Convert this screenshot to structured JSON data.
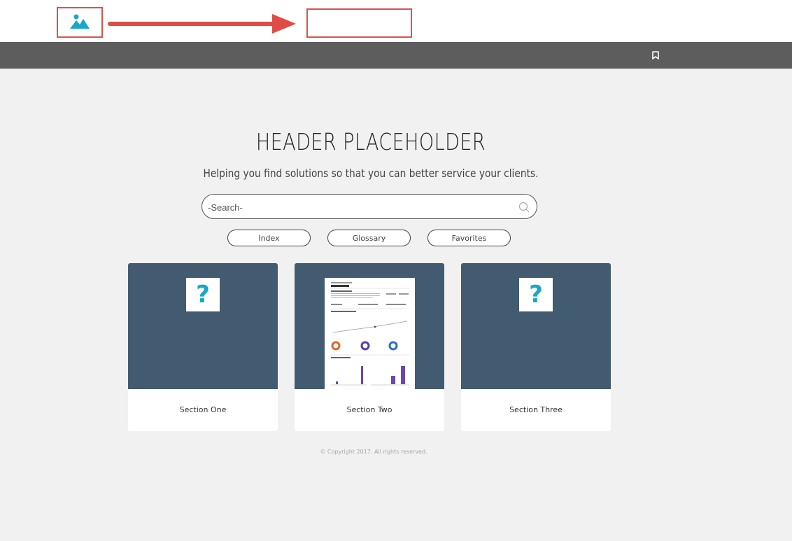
{
  "header": {
    "logo_icon": "image-placeholder-icon",
    "bookmark_icon": "bookmark-icon"
  },
  "hero": {
    "title": "HEADER PLACEHOLDER",
    "subtitle": "Helping you find solutions so that you can better service your clients."
  },
  "search": {
    "placeholder": "-Search-",
    "icon": "search-icon"
  },
  "links": [
    {
      "label": "Index"
    },
    {
      "label": "Glossary"
    },
    {
      "label": "Favorites"
    }
  ],
  "cards": [
    {
      "label": "Section One",
      "media": "question-mark-icon"
    },
    {
      "label": "Section Two",
      "media": "document-thumbnail"
    },
    {
      "label": "Section Three",
      "media": "question-mark-icon"
    }
  ],
  "footer": {
    "copyright": "© Copyright 2017. All rights reserved."
  },
  "colors": {
    "annotation_red": "#d9534f",
    "nav_gray": "#5d5d5d",
    "card_blue": "#435b70",
    "accent_teal": "#17a7c8"
  }
}
